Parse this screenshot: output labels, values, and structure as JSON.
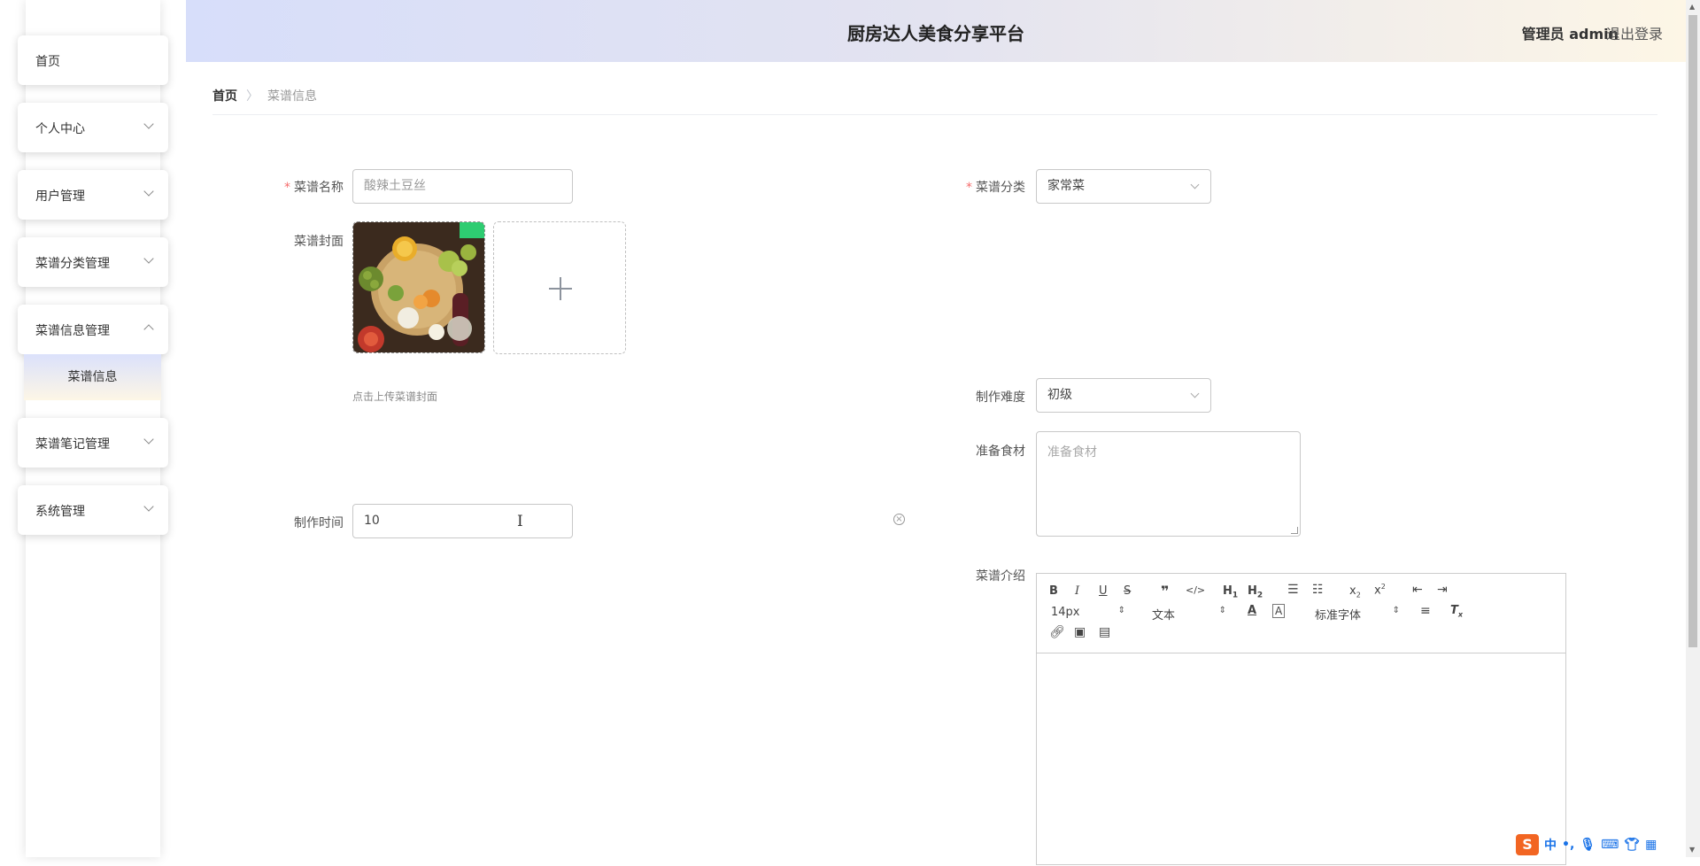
{
  "header": {
    "site_title": "厨房达人美食分享平台",
    "user_label": "管理员 admin",
    "logout": "退出登录"
  },
  "sidebar": {
    "items": [
      {
        "label": "首页"
      },
      {
        "label": "个人中心"
      },
      {
        "label": "用户管理"
      },
      {
        "label": "菜谱分类管理"
      },
      {
        "label": "菜谱信息管理"
      },
      {
        "label": "菜谱笔记管理"
      },
      {
        "label": "系统管理"
      }
    ],
    "submenu": {
      "label": "菜谱信息"
    }
  },
  "breadcrumb": {
    "home": "首页",
    "separator": "〉",
    "current": "菜谱信息"
  },
  "form": {
    "name": {
      "label": "菜谱名称",
      "value": "酸辣土豆丝"
    },
    "category": {
      "label": "菜谱分类",
      "value": "家常菜"
    },
    "cover": {
      "label": "菜谱封面",
      "tip": "点击上传菜谱封面"
    },
    "difficulty": {
      "label": "制作难度",
      "value": "初级"
    },
    "ingredients": {
      "label": "准备食材",
      "placeholder": "准备食材"
    },
    "time": {
      "label": "制作时间",
      "value": "10"
    },
    "intro": {
      "label": "菜谱介绍"
    }
  },
  "editor": {
    "font_size": "14px",
    "header_select": "文本",
    "font_family": "标准字体"
  },
  "ime": {
    "glyph": "S",
    "mode": "中",
    "punct": "•,"
  }
}
